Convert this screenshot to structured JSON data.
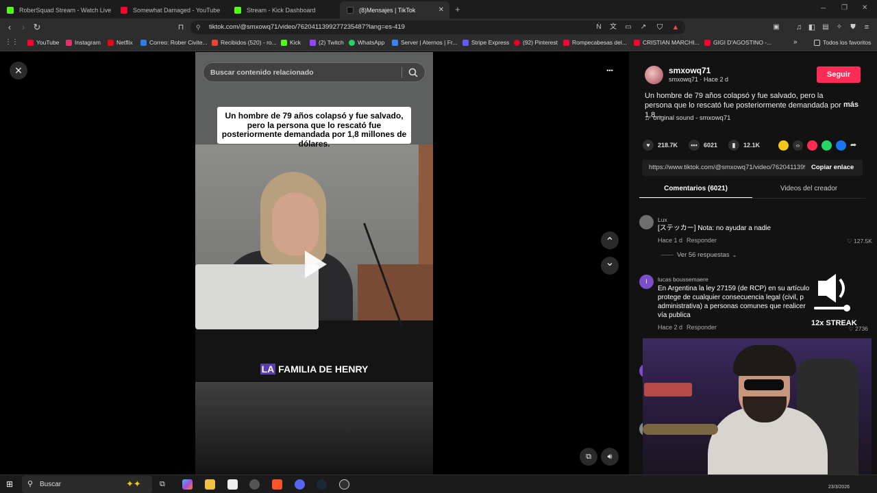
{
  "browser": {
    "tabs": [
      {
        "title": "RoberSquad Stream - Watch Live",
        "color": "#53fc18"
      },
      {
        "title": "Somewhat Damaged - YouTube",
        "color": "#ff0033"
      },
      {
        "title": "Stream - Kick Dashboard",
        "color": "#53fc18"
      },
      {
        "title": "(8)Mensajes | TikTok",
        "color": "#111111",
        "active": true
      }
    ],
    "new_tab": "+",
    "url": "tiktok.com/@smxowq71/video/7620411399277235487?lang=es-419",
    "bookmarks": [
      {
        "label": "YouTube",
        "color": "#ff0033"
      },
      {
        "label": "Instagram",
        "color": "#e1306c"
      },
      {
        "label": "Netflix",
        "color": "#e50914"
      },
      {
        "label": "Correo: Rober Civite...",
        "color": "#2f7de1"
      },
      {
        "label": "Recibidos (520) - ro...",
        "color": "#ea4335"
      },
      {
        "label": "Kick",
        "color": "#53fc18"
      },
      {
        "label": "(2) Twitch",
        "color": "#9146ff"
      },
      {
        "label": "WhatsApp",
        "color": "#25d366"
      },
      {
        "label": "Server | Aternos | Fr...",
        "color": "#3b82f6"
      },
      {
        "label": "Stripe Express",
        "color": "#635bff"
      },
      {
        "label": "(92) Pinterest",
        "color": "#e60023"
      },
      {
        "label": "Rompecabesas del...",
        "color": "#ff0033"
      },
      {
        "label": "CRISTIAN MARCHI...",
        "color": "#ff0033"
      },
      {
        "label": "GIGI D'AGOSTINO -...",
        "color": "#ff0033"
      }
    ],
    "bookmarks_overflow": "»",
    "all_favorites": "Todos los favoritos"
  },
  "video": {
    "search_placeholder": "Buscar contenido relacionado",
    "caption_box": "Un hombre de 79 años colapsó y fue salvado, pero la persona que lo rescató fue posteriormente demandada por 1,8 millones de dólares.",
    "subtitle_highlight": "LA",
    "subtitle_rest": " FAMILIA DE HENRY",
    "close_icon": "×",
    "more_icon": "•••",
    "up_icon": "⌃",
    "down_icon": "⌄"
  },
  "sidebar": {
    "username": "smxowq71",
    "handle_time": "smxowq71 · Hace 2 d",
    "follow_label": "Seguir",
    "description": "Un hombre de 79 años colapsó y fue salvado, pero la persona que lo rescató fue posteriormente demandada por 1,8...",
    "more_label": "más",
    "sound": "original sound - smxowq71",
    "likes": "218.7K",
    "comments": "6021",
    "saves": "12.1K",
    "share_link": "https://www.tiktok.com/@smxowq71/video/7620411399277235487",
    "copy_label": "Copiar enlace",
    "tab_comments": "Comentarios (6021)",
    "tab_videos": "Videos del creador",
    "comment_items": [
      {
        "user": "Lux",
        "text": "[ステッカー] Nota: no ayudar a nadie",
        "time": "Hace 1 d",
        "reply": "Responder",
        "likes": "127.5K",
        "avatar_color": "#6e6e6e"
      },
      {
        "user": "lucas boussemaere",
        "text": "En Argentina la ley 27159 (de RCP) en su artículo protege de cualquier consecuencia legal (civil, p administrativa) a personas comunes que realicer vía publica",
        "time": "Hace 2 d",
        "reply": "Responder",
        "likes": "2736",
        "avatar_letter": "l",
        "avatar_color": "#7b4fc9"
      }
    ],
    "replies_label": "Ver 56 respuestas"
  },
  "overlay": {
    "streak": "12x STREAK"
  },
  "taskbar": {
    "search_placeholder": "Buscar",
    "date": "23/3/2026"
  }
}
